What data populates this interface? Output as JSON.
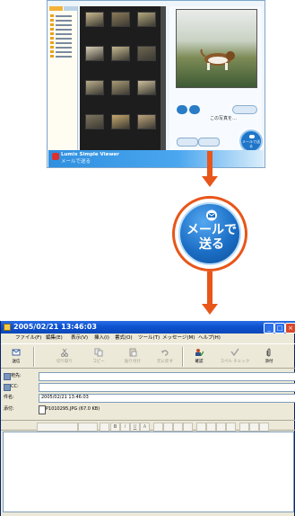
{
  "viewer": {
    "app_name": "Lumix Simple Viewer",
    "app_subtitle": "メールで送る",
    "preview_caption": "この写真を…",
    "send_button_label": "メールで送る",
    "thumb_colors": [
      "#c9b98e",
      "#8c7a5a",
      "#b3a77e",
      "#d8cfb8",
      "#c4b690",
      "#6d6552",
      "#b9ad8a",
      "#a89a74",
      "#cdbf9c",
      "#7f7560",
      "#c7a86e",
      "#bda47c"
    ],
    "accent_color": "#1f76c9"
  },
  "callout": {
    "send_button_label_line1": "メールで",
    "send_button_label_line2": "送る",
    "arrow_color": "#e8561a"
  },
  "mail": {
    "title": "2005/02/21 13:46:03",
    "menu": [
      "ファイル(F)",
      "編集(E)",
      "表示(V)",
      "挿入(I)",
      "書式(O)",
      "ツール(T)",
      "メッセージ(M)",
      "ヘルプ(H)"
    ],
    "toolbar": [
      {
        "label": "送信",
        "icon": "send-icon",
        "enabled": true
      },
      {
        "label": "切り取り",
        "icon": "cut-icon",
        "enabled": false
      },
      {
        "label": "コピー",
        "icon": "copy-icon",
        "enabled": false
      },
      {
        "label": "貼り付け",
        "icon": "paste-icon",
        "enabled": false
      },
      {
        "label": "元に戻す",
        "icon": "undo-icon",
        "enabled": false
      },
      {
        "label": "確認",
        "icon": "check-names-icon",
        "enabled": true
      },
      {
        "label": "スペル チェック",
        "icon": "spellcheck-icon",
        "enabled": false
      },
      {
        "label": "添付",
        "icon": "attach-icon",
        "enabled": true
      }
    ],
    "to_label": "宛先:",
    "cc_label": "CC:",
    "subject_label": "件名:",
    "subject_value": "2005/02/21 13:46:03",
    "attach_label": "添付:",
    "attachment": "P1010295.JPG (67.0 KB)",
    "format_buttons": [
      "B",
      "I",
      "U",
      "A"
    ]
  }
}
